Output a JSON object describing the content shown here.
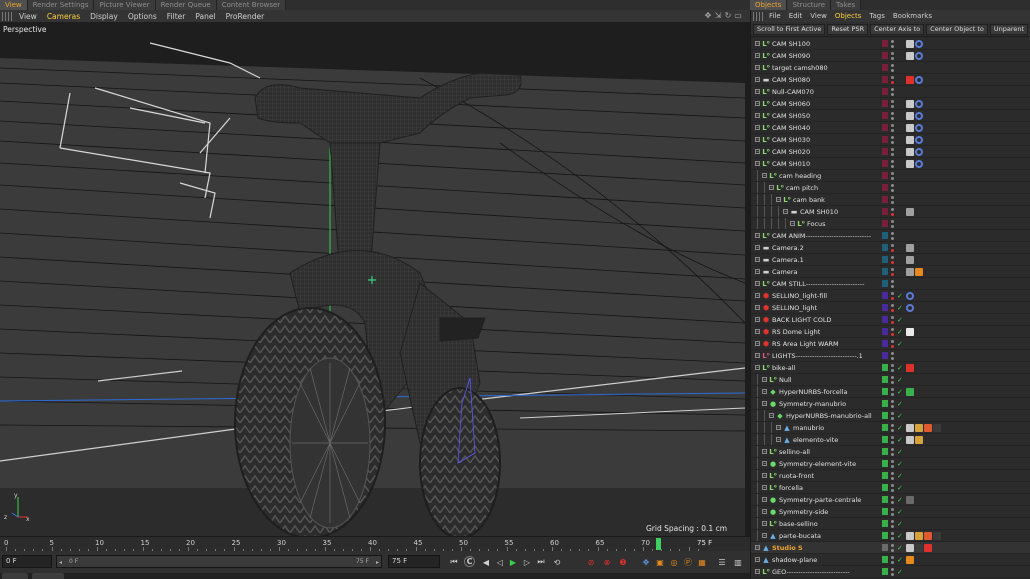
{
  "tabs_left": [
    "View",
    "Render Settings",
    "Picture Viewer",
    "Render Queue",
    "Content Browser"
  ],
  "tabs_left_active": 0,
  "tabs_right": [
    "Objects",
    "Structure",
    "Takes"
  ],
  "viewport_menu": [
    "View",
    "Cameras",
    "Display",
    "Options",
    "Filter",
    "Panel",
    "ProRender"
  ],
  "viewport_menu_active": "Cameras",
  "viewport_label": "Perspective",
  "grid_spacing": "Grid Spacing : 0.1 cm",
  "timeline": {
    "ticks": [
      "0",
      "5",
      "10",
      "15",
      "20",
      "25",
      "30",
      "35",
      "40",
      "45",
      "50",
      "55",
      "60",
      "65",
      "70"
    ],
    "end_label": "75 F",
    "current_frame": 71
  },
  "transport": {
    "start_field": "0 F",
    "range_start": "0 F",
    "range_end": "75 F",
    "end_field": "75 F"
  },
  "object_manager": {
    "menu": [
      "File",
      "Edit",
      "View",
      "Objects",
      "Tags",
      "Bookmarks"
    ],
    "menu_active": "Objects",
    "toolbar": [
      "Scroll to First Active",
      "Reset PSR",
      "Center Axis to",
      "Center Object to",
      "Unparent"
    ],
    "rows": [
      {
        "name": "CAM SH100",
        "depth": 0,
        "type": "null",
        "lamp": "#7a1f3a",
        "tags": [
          "#c9c9c9",
          "#5a7bd8"
        ]
      },
      {
        "name": "CAM SH090",
        "depth": 0,
        "type": "null",
        "lamp": "#7a1f3a",
        "tags": [
          "#c9c9c9",
          "#5a7bd8"
        ]
      },
      {
        "name": "target camsh080",
        "depth": 0,
        "type": "null",
        "lamp": "#7a1f3a",
        "tags": []
      },
      {
        "name": "CAM  SH080",
        "depth": 0,
        "type": "camera",
        "lamp": "#7a1f3a",
        "tags": [
          "#e0322d",
          "#5a7bd8"
        ]
      },
      {
        "name": "Null-CAM070",
        "depth": 0,
        "type": "null",
        "lamp": "#7a1f3a",
        "tags": []
      },
      {
        "name": "CAM SH060",
        "depth": 0,
        "type": "null",
        "lamp": "#7a1f3a",
        "tags": [
          "#c9c9c9",
          "#5a7bd8"
        ]
      },
      {
        "name": "CAM SH050",
        "depth": 0,
        "type": "null",
        "lamp": "#7a1f3a",
        "tags": [
          "#c9c9c9",
          "#5a7bd8"
        ]
      },
      {
        "name": "CAM SH040",
        "depth": 0,
        "type": "null",
        "lamp": "#7a1f3a",
        "tags": [
          "#c9c9c9",
          "#5a7bd8"
        ]
      },
      {
        "name": "CAM SH030",
        "depth": 0,
        "type": "null",
        "lamp": "#7a1f3a",
        "tags": [
          "#c9c9c9",
          "#5a7bd8"
        ]
      },
      {
        "name": "CAM SH020",
        "depth": 0,
        "type": "null",
        "lamp": "#7a1f3a",
        "tags": [
          "#c9c9c9",
          "#5a7bd8"
        ]
      },
      {
        "name": "CAM SH010",
        "depth": 0,
        "type": "null",
        "lamp": "#7a1f3a",
        "tags": [
          "#c9c9c9",
          "#5a7bd8"
        ]
      },
      {
        "name": "cam heading",
        "depth": 1,
        "type": "null",
        "lamp": "#7a1f3a",
        "tags": []
      },
      {
        "name": "cam pitch",
        "depth": 2,
        "type": "null",
        "lamp": "#7a1f3a",
        "tags": []
      },
      {
        "name": "cam bank",
        "depth": 3,
        "type": "null",
        "lamp": "#7a1f3a",
        "tags": []
      },
      {
        "name": "CAM SH010",
        "depth": 4,
        "type": "camera",
        "lamp": "#7a1f3a",
        "tags": [
          "#a0a0a0"
        ]
      },
      {
        "name": "Focus",
        "depth": 5,
        "type": "null",
        "lamp": "#7a1f3a",
        "tags": []
      },
      {
        "name": "CAM ANIM----------------------------",
        "depth": 0,
        "type": "null",
        "lamp": "#1f5f7a",
        "tags": []
      },
      {
        "name": "Camera.2",
        "depth": 0,
        "type": "camera",
        "lamp": "#1f5f7a",
        "tags": [
          "#a0a0a0"
        ]
      },
      {
        "name": "Camera.1",
        "depth": 0,
        "type": "camera",
        "lamp": "#1f5f7a",
        "tags": [
          "#a0a0a0"
        ]
      },
      {
        "name": "Camera",
        "depth": 0,
        "type": "camera",
        "lamp": "#1f5f7a",
        "tags": [
          "#a0a0a0",
          "#e68a1e"
        ]
      },
      {
        "name": "CAM STILL-------------------------",
        "depth": 0,
        "type": "null",
        "lamp": "#1f5f7a",
        "tags": []
      },
      {
        "name": "SELLINO_light-fill",
        "depth": 0,
        "type": "light",
        "lamp": "#4a2a9a",
        "tags": [
          "#5a7bd8"
        ]
      },
      {
        "name": "SELLINO_light",
        "depth": 0,
        "type": "light",
        "lamp": "#4a2a9a",
        "tags": [
          "#5a7bd8"
        ]
      },
      {
        "name": "BACK LIGHT COLD",
        "depth": 0,
        "type": "light",
        "lamp": "#4a2a9a",
        "tags": []
      },
      {
        "name": "RS Dome Light",
        "depth": 0,
        "type": "light",
        "lamp": "#4a2a9a",
        "tags": [
          "#eaeaea"
        ]
      },
      {
        "name": "RS Area Light WARM",
        "depth": 0,
        "type": "light",
        "lamp": "#4a2a9a",
        "tags": []
      },
      {
        "name": "LIGHTS--------------------------.1",
        "depth": 0,
        "type": "null-red",
        "lamp": "#4a2a9a",
        "tags": []
      },
      {
        "name": "bike-all",
        "depth": 0,
        "type": "null",
        "lamp": "#3ab04b",
        "tags": [
          "#e0322d"
        ]
      },
      {
        "name": "Null",
        "depth": 1,
        "type": "null",
        "lamp": "#3ab04b",
        "tags": []
      },
      {
        "name": "HyperNURBS-forcella",
        "depth": 1,
        "type": "nurbs",
        "lamp": "#3ab04b",
        "tags": [
          "#3ab04b"
        ]
      },
      {
        "name": "Symmetry-manubrio",
        "depth": 1,
        "type": "sym",
        "lamp": "#3ab04b",
        "tags": []
      },
      {
        "name": "HyperNURBS-manubrio-all",
        "depth": 2,
        "type": "nurbs",
        "lamp": "#3ab04b",
        "tags": []
      },
      {
        "name": "manubrio",
        "depth": 3,
        "type": "poly",
        "lamp": "#3ab04b",
        "tags": [
          "#c9c9c9",
          "#d6a33a",
          "#e05a2d",
          "#3a3a3a"
        ]
      },
      {
        "name": "elemento-vite",
        "depth": 3,
        "type": "poly",
        "lamp": "#3ab04b",
        "tags": [
          "#c9c9c9",
          "#d6a33a"
        ]
      },
      {
        "name": "sellino-all",
        "depth": 1,
        "type": "null",
        "lamp": "#3ab04b",
        "tags": []
      },
      {
        "name": "Symmetry-element-vite",
        "depth": 1,
        "type": "sym",
        "lamp": "#3ab04b",
        "tags": []
      },
      {
        "name": "ruota-front",
        "depth": 1,
        "type": "null",
        "lamp": "#3ab04b",
        "tags": []
      },
      {
        "name": "forcella",
        "depth": 1,
        "type": "null",
        "lamp": "#3ab04b",
        "tags": []
      },
      {
        "name": "Symmetry-parte-centrale",
        "depth": 1,
        "type": "sym",
        "lamp": "#3ab04b",
        "tags": [
          "#6a6a6a"
        ]
      },
      {
        "name": "Symmetry-side",
        "depth": 1,
        "type": "sym",
        "lamp": "#3ab04b",
        "tags": []
      },
      {
        "name": "base-sellino",
        "depth": 1,
        "type": "null",
        "lamp": "#3ab04b",
        "tags": []
      },
      {
        "name": "parte-bucata",
        "depth": 1,
        "type": "poly",
        "lamp": "#3ab04b",
        "tags": [
          "#c9c9c9",
          "#d6a33a",
          "#e05a2d",
          "#3a3a3a"
        ]
      },
      {
        "name": "Studio S",
        "depth": 0,
        "type": "poly",
        "lamp": "#6a6a6a",
        "tags": [
          "#c9c9c9",
          "#3a3a3a",
          "#e0322d"
        ],
        "highlight": true
      },
      {
        "name": "shadow-plane",
        "depth": 0,
        "type": "poly",
        "lamp": "#3ab04b",
        "tags": [
          "#e68a1e"
        ]
      },
      {
        "name": "GEO---------------------------",
        "depth": 0,
        "type": "null",
        "lamp": "#3ab04b",
        "tags": []
      }
    ]
  }
}
